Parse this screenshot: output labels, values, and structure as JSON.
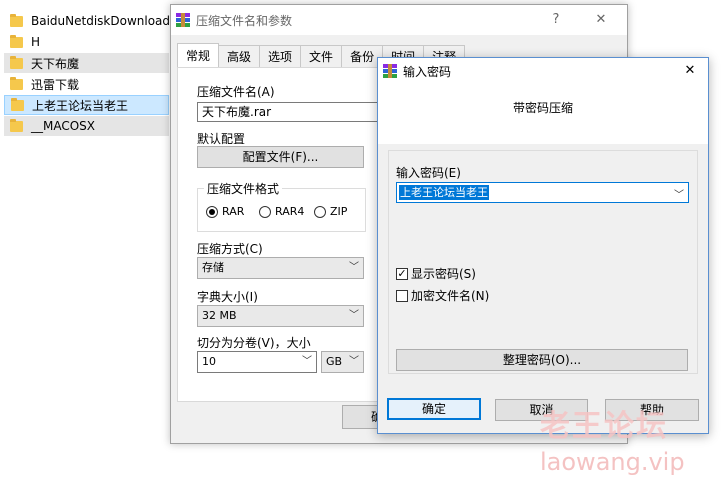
{
  "explorer": {
    "items": [
      {
        "label": "BaiduNetdiskDownload"
      },
      {
        "label": "H"
      },
      {
        "label": "天下布魔"
      },
      {
        "label": "迅雷下载"
      },
      {
        "label": "上老王论坛当老王"
      },
      {
        "label": "__MACOSX"
      }
    ]
  },
  "archive_dialog": {
    "title": "压缩文件名和参数",
    "help_btn": "?",
    "close_btn": "✕",
    "tabs": [
      {
        "label": "常规"
      },
      {
        "label": "高级"
      },
      {
        "label": "选项"
      },
      {
        "label": "文件"
      },
      {
        "label": "备份"
      },
      {
        "label": "时间"
      },
      {
        "label": "注释"
      }
    ],
    "archive_name_label": "压缩文件名(A)",
    "archive_name_value": "天下布魔.rar",
    "default_profile_label": "默认配置",
    "profiles_btn": "配置文件(F)...",
    "format_label": "压缩文件格式",
    "format_options": [
      {
        "label": "RAR",
        "selected": true
      },
      {
        "label": "RAR4",
        "selected": false
      },
      {
        "label": "ZIP",
        "selected": false
      }
    ],
    "method_label": "压缩方式(C)",
    "method_value": "存储",
    "dict_label": "字典大小(I)",
    "dict_value": "32 MB",
    "split_label": "切分为分卷(V)，大小",
    "split_value": "10",
    "split_unit": "GB",
    "ok_btn_partial": "确"
  },
  "password_dialog": {
    "title": "输入密码",
    "close_btn": "✕",
    "heading": "带密码压缩",
    "enter_label": "输入密码(E)",
    "password_value": "上老王论坛当老王",
    "show_password_label": "显示密码(S)",
    "show_password_checked": true,
    "encrypt_names_label": "加密文件名(N)",
    "encrypt_names_checked": false,
    "organize_btn": "整理密码(O)...",
    "ok_btn": "确定",
    "cancel_btn": "取消",
    "help_btn": "帮助"
  },
  "watermark": {
    "cn": "老王论坛",
    "en": "laowang.vip"
  }
}
